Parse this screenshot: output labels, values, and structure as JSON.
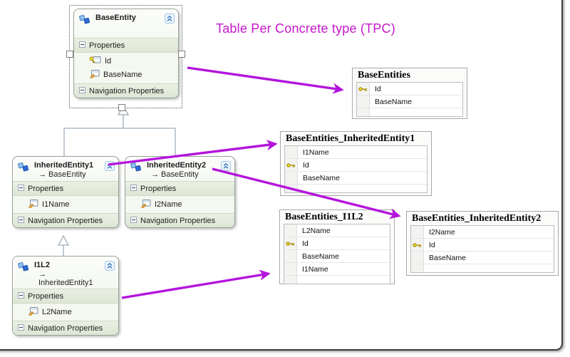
{
  "title": {
    "text": "Table Per Concrete type (TPC)"
  },
  "colors": {
    "heading": "#C516CB",
    "arrow": "#B414DC",
    "connector": "#8696A8",
    "entity_border": "#95A295",
    "table_border": "#A6A6A6",
    "key_gold": "#B99A00"
  },
  "labels": {
    "properties": "Properties",
    "navigation": "Navigation Properties",
    "inherits_arrow": "→"
  },
  "icons": {
    "entity": "entity-icon",
    "collapse": "chevron-double-up-icon",
    "expander": "minus-expander-icon",
    "property": "property-icon",
    "key_property": "key-property-icon",
    "table_key": "key-icon"
  },
  "entities": [
    {
      "name": "BaseEntity",
      "base": null,
      "selected": true,
      "properties": [
        {
          "name": "Id",
          "key": true
        },
        {
          "name": "BaseName",
          "key": false
        }
      ]
    },
    {
      "name": "InheritedEntity1",
      "base": "BaseEntity",
      "selected": false,
      "properties": [
        {
          "name": "I1Name",
          "key": false
        }
      ]
    },
    {
      "name": "InheritedEntity2",
      "base": "BaseEntity",
      "selected": false,
      "properties": [
        {
          "name": "I2Name",
          "key": false
        }
      ]
    },
    {
      "name": "I1L2",
      "base": "InheritedEntity1",
      "selected": false,
      "properties": [
        {
          "name": "L2Name",
          "key": false
        }
      ]
    }
  ],
  "tables": [
    {
      "name": "BaseEntities",
      "columns": [
        {
          "name": "Id",
          "key": true
        },
        {
          "name": "BaseName",
          "key": false
        }
      ]
    },
    {
      "name": "BaseEntities_InheritedEntity1",
      "columns": [
        {
          "name": "I1Name",
          "key": false
        },
        {
          "name": "Id",
          "key": true
        },
        {
          "name": "BaseName",
          "key": false
        }
      ]
    },
    {
      "name": "BaseEntities_I1L2",
      "columns": [
        {
          "name": "L2Name",
          "key": false
        },
        {
          "name": "Id",
          "key": true
        },
        {
          "name": "BaseName",
          "key": false
        },
        {
          "name": "I1Name",
          "key": false
        }
      ]
    },
    {
      "name": "BaseEntities_InheritedEntity2",
      "columns": [
        {
          "name": "I2Name",
          "key": false
        },
        {
          "name": "Id",
          "key": true
        },
        {
          "name": "BaseName",
          "key": false
        }
      ]
    }
  ]
}
